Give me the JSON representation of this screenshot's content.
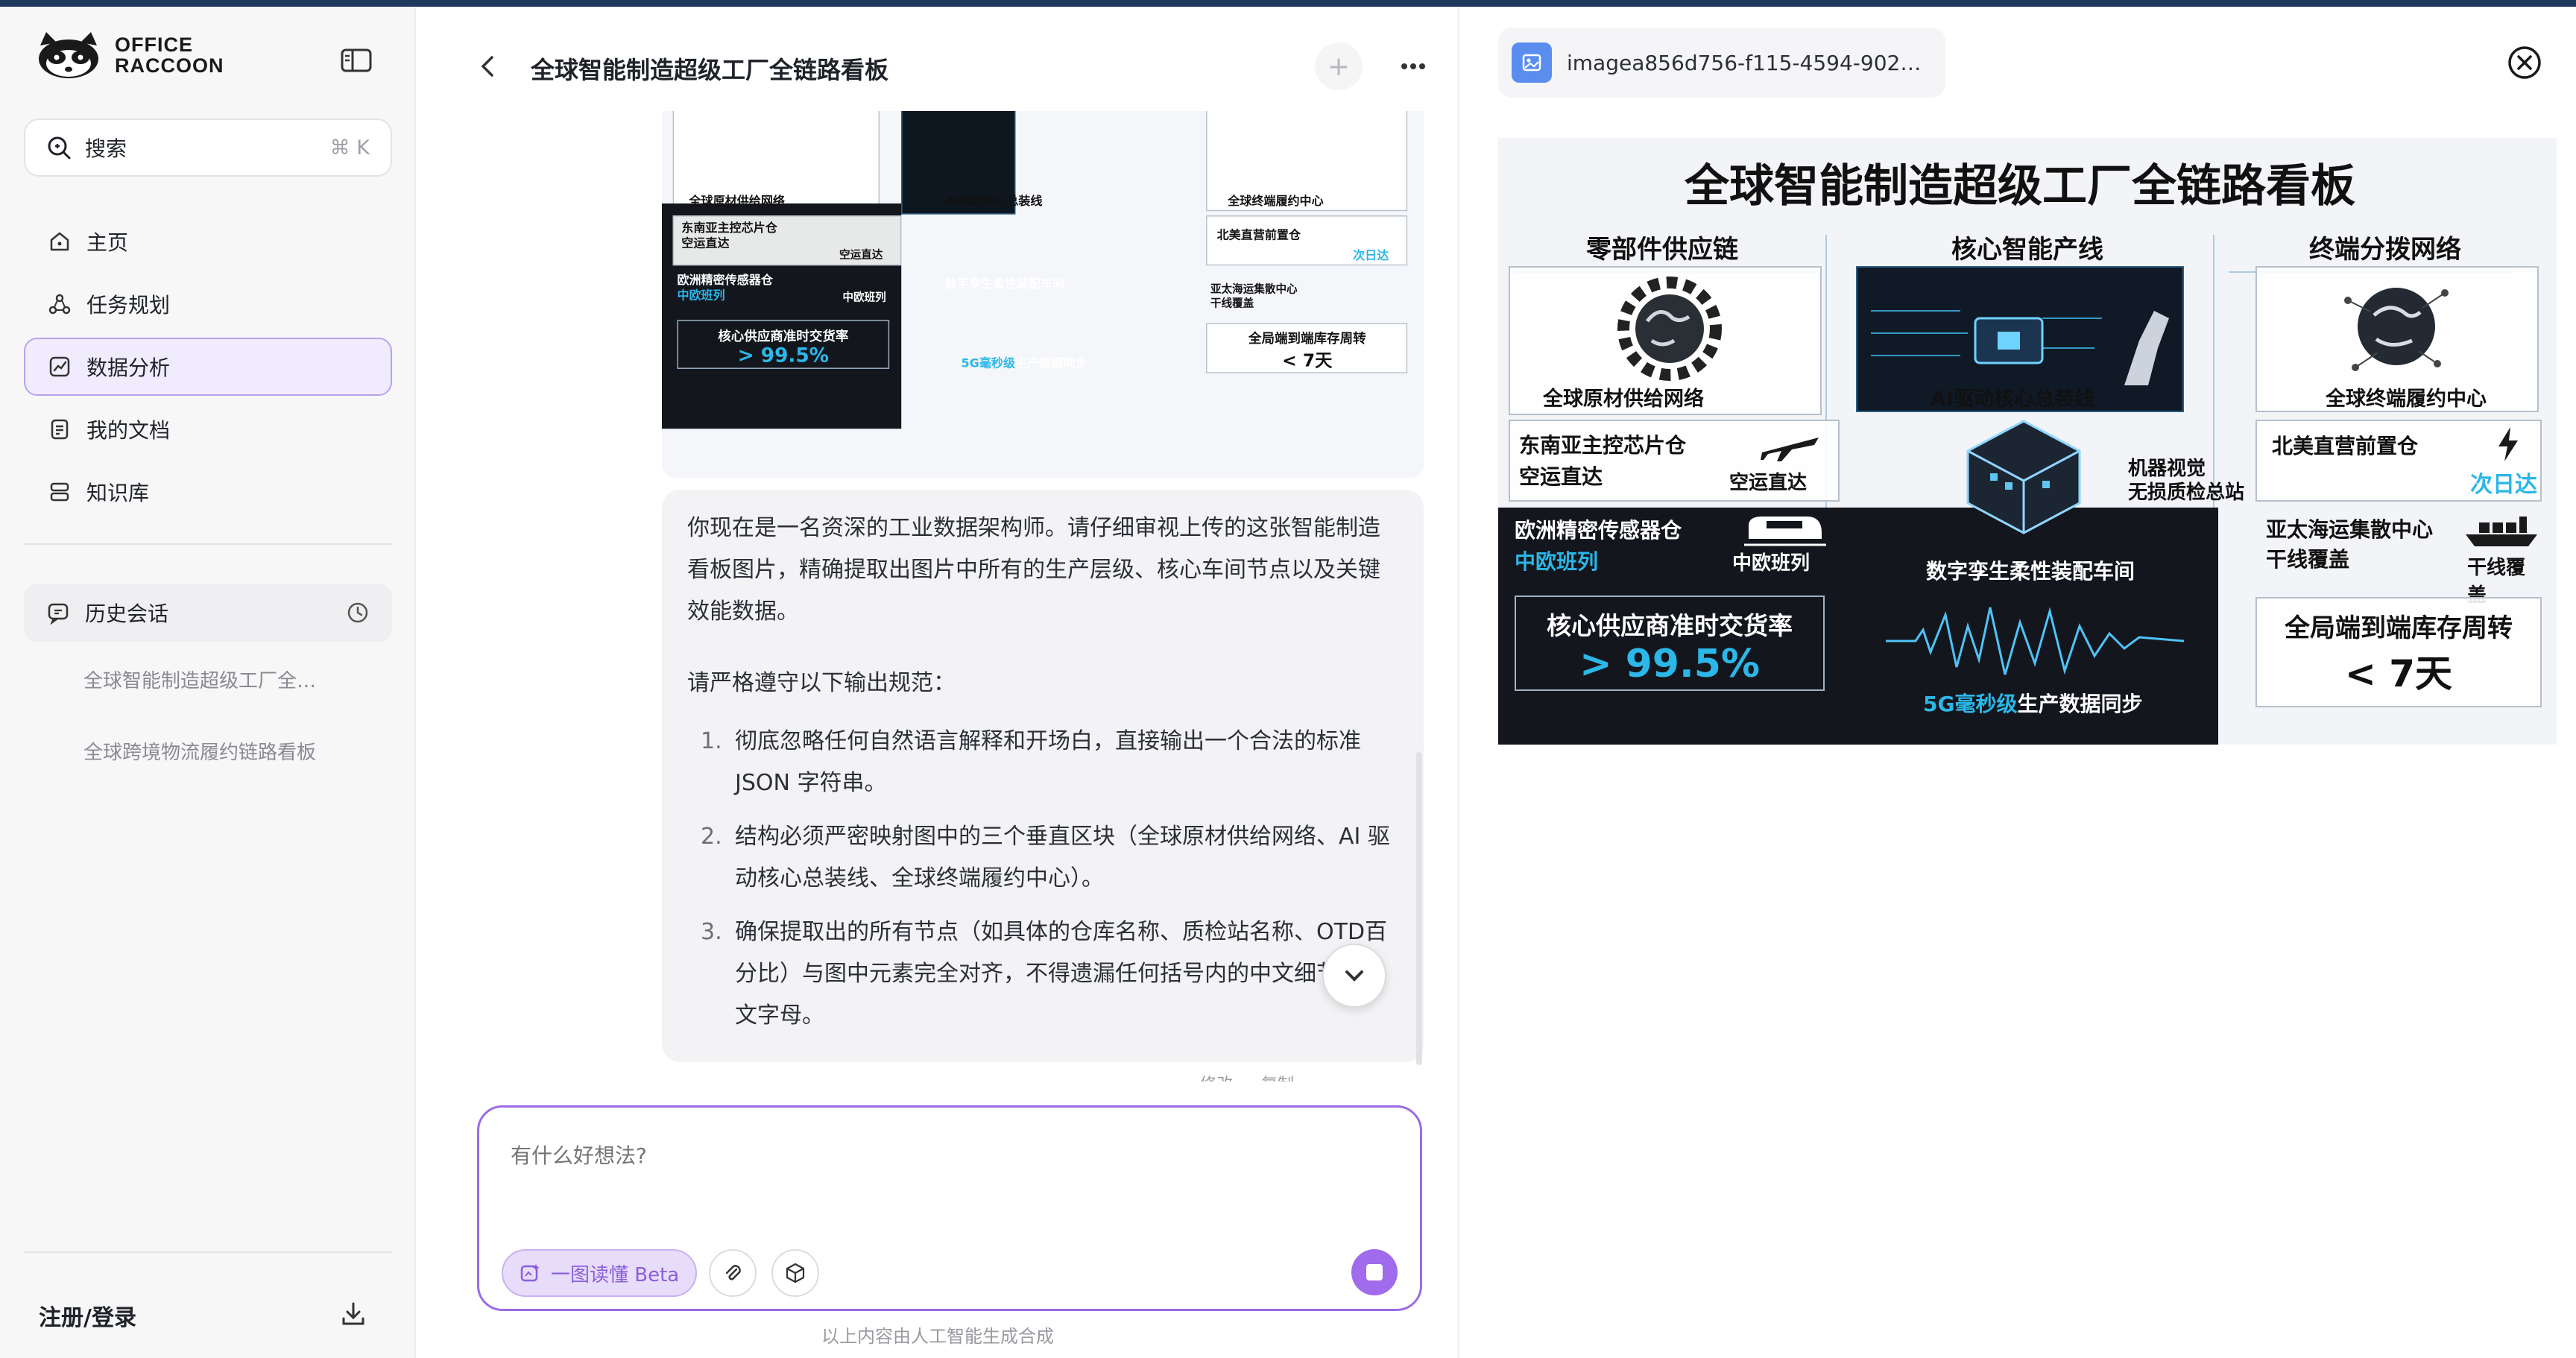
{
  "app": {
    "brand_line1": "OFFICE",
    "brand_line2": "RACCOON"
  },
  "sidebar": {
    "search_label": "搜索",
    "search_shortcut": "⌘ K",
    "nav": [
      {
        "label": "主页",
        "icon": "home-icon"
      },
      {
        "label": "任务规划",
        "icon": "task-plan-icon"
      },
      {
        "label": "数据分析",
        "icon": "chart-icon",
        "active": true
      },
      {
        "label": "我的文档",
        "icon": "document-icon"
      },
      {
        "label": "知识库",
        "icon": "knowledge-base-icon"
      }
    ],
    "history_label": "历史会话",
    "history_items": [
      "全球智能制造超级工厂全链路看板",
      "全球跨境物流履约链路看板"
    ],
    "login_label": "注册/登录"
  },
  "chat": {
    "title": "全球智能制造超级工厂全链路看板",
    "message": {
      "intro": "你现在是一名资深的工业数据架构师。请仔细审视上传的这张智能制造看板图片，精确提取出图片中所有的生产层级、核心车间节点以及关键效能数据。",
      "rules_heading": "请严格遵守以下输出规范：",
      "rules": [
        {
          "num": "1.",
          "text": "彻底忽略任何自然语言解释和开场白，直接输出一个合法的标准 JSON 字符串。"
        },
        {
          "num": "2.",
          "text": "结构必须严密映射图中的三个垂直区块（全球原材供给网络、AI 驱动核心总装线、全球终端履约中心）。"
        },
        {
          "num": "3.",
          "text": "确保提取出的所有节点（如具体的仓库名称、质检站名称、OTD百分比）与图中元素完全对齐，不得遗漏任何括号内的中文细节或英文字母。"
        }
      ],
      "actions": [
        "修改",
        "复制"
      ]
    },
    "composer_placeholder": "有什么好想法?",
    "chip_label": "一图读懂 Beta",
    "footnote": "以上内容由人工智能生成合成"
  },
  "preview": {
    "file_name": "imagea856d756-f115-4594-9021-cd62f…"
  },
  "infographic": {
    "title": "全球智能制造超级工厂全链路看板",
    "col_left": "零部件供应链",
    "col_mid": "核心智能产线",
    "col_right": "终端分拨网络",
    "left_node": "全球原材供给网络",
    "mid_node": "AI驱动核心总装线",
    "right_node": "全球终端履约中心",
    "sea_hub": "东南亚主控芯片仓",
    "sea_hub_sub": "空运直达",
    "sea_mode": "空运直达",
    "eu_hub": "欧洲精密传感器仓",
    "eu_hub_sub": "中欧班列",
    "eu_mode": "中欧班列",
    "kpi_left_label": "核心供应商准时交货率",
    "kpi_left_value": "> 99.5%",
    "vision": "机器视觉",
    "vision_sub": "无损质检总站",
    "twin": "数字孪生柔性装配车间",
    "sync_prefix": "5G毫秒级",
    "sync_suffix": "生产数据同步",
    "na_hub": "北美直营前置仓",
    "na_mode": "次日达",
    "apac_hub": "亚太海运集散中心",
    "apac_hub_sub": "干线覆盖",
    "apac_mode": "干线覆盖",
    "kpi_right_label": "全局端到端库存周转",
    "kpi_right_value": "< 7天"
  },
  "colors": {
    "accent": "#9b6ce6",
    "active_bg": "#f1ecfd",
    "cyan": "#2bb7e8",
    "dark_panel": "#13161c"
  }
}
